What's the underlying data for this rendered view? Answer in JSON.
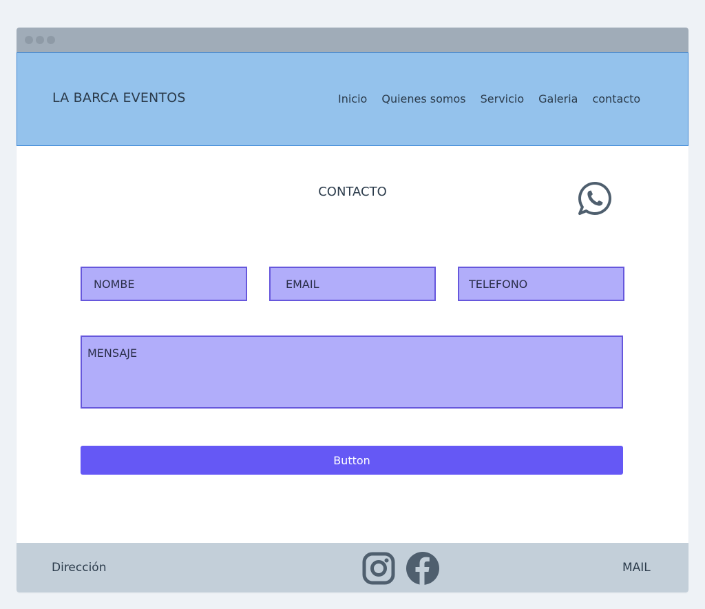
{
  "header": {
    "brand": "LA BARCA EVENTOS",
    "nav": [
      "Inicio",
      "Quienes somos",
      "Servicio",
      "Galeria",
      "contacto"
    ]
  },
  "contact": {
    "title": "CONTACTO",
    "whatsapp_icon": "whatsapp-icon",
    "fields": {
      "name_placeholder": "NOMBE",
      "email_placeholder": "EMAIL",
      "phone_placeholder": "TELEFONO",
      "message_placeholder": "MENSAJE"
    },
    "submit_label": "Button"
  },
  "footer": {
    "address": "Dirección",
    "mail": "MAIL",
    "icons": [
      "instagram-icon",
      "facebook-icon"
    ]
  },
  "colors": {
    "header_bg": "#94c2ec",
    "input_bg": "#b1adfa",
    "input_border": "#6657dc",
    "button_bg": "#6558f5",
    "footer_bg": "#c3cfd9",
    "icon": "#4f5f6e"
  }
}
